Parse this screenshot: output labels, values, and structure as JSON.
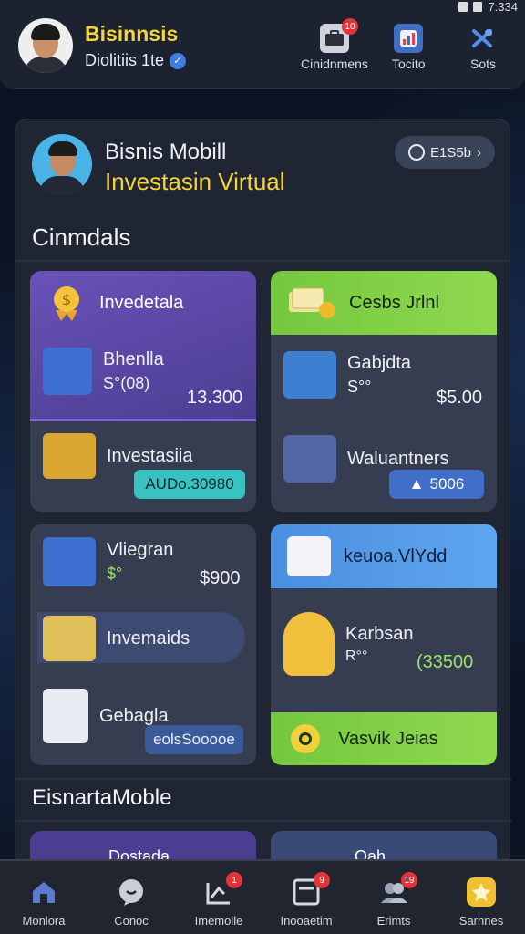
{
  "status_bar": {
    "time": "7:334"
  },
  "header": {
    "title": "Bisinnsis",
    "subtitle": "Diolitiis 1te",
    "nav": [
      {
        "label": "Cinidnmens",
        "icon": "briefcase-icon",
        "badge": "10"
      },
      {
        "label": "Tocito",
        "icon": "chart-icon",
        "badge": ""
      },
      {
        "label": "Sots",
        "icon": "tools-icon",
        "badge": ""
      }
    ]
  },
  "profile": {
    "title": "Bisnis Mobill",
    "subtitle": "Investasin Virtual",
    "pill_label": "E1S5b"
  },
  "sections": {
    "first": "Cinmdals",
    "second": "EisnartaMoble"
  },
  "cards": {
    "purple": {
      "head": "Invedetala",
      "row1_label": "Bhenlla",
      "row1_sub": "S°(08)",
      "row1_amount": "13.300",
      "row2_label": "Investasiia",
      "row2_tag": "AUDo.30980"
    },
    "green": {
      "head": "Cesbs Jrlnl",
      "row1_label": "Gabjdta",
      "row1_sub": "S°°",
      "row1_amount": "$5.00",
      "row2_label": "Waluantners",
      "row2_tag": "5006"
    },
    "dark": {
      "row1_label": "Vliegran",
      "row1_sub": "$°",
      "row1_amount": "$900",
      "row2_label": "Invemaids",
      "row3_label": "Gebagla",
      "row3_tag": "eolsSooooe"
    },
    "blue": {
      "head": "keuoa.VlYdd",
      "row1_label": "Karbsan",
      "row1_sub": "R°°",
      "row1_amount": "(33500",
      "foot": "Vasvik Jeias"
    }
  },
  "bottom_cards": {
    "left_label": "Dostada",
    "right_label": "Qah"
  },
  "bottom_nav": [
    {
      "label": "Monlora",
      "icon": "home-icon",
      "badge": ""
    },
    {
      "label": "Conoc",
      "icon": "chat-icon",
      "badge": ""
    },
    {
      "label": "Imemoile",
      "icon": "trend-icon",
      "badge": "1"
    },
    {
      "label": "Inooaetim",
      "icon": "document-icon",
      "badge": "9"
    },
    {
      "label": "Erimts",
      "icon": "people-icon",
      "badge": "19"
    },
    {
      "label": "Sarnnes",
      "icon": "star-icon",
      "badge": ""
    }
  ],
  "colors": {
    "accent_yellow": "#f5d43c",
    "purple_card": "#5e4aa8",
    "green_card": "#86d44b",
    "blue_card": "#4a8fe0",
    "teal_tag": "#38c2c2"
  }
}
